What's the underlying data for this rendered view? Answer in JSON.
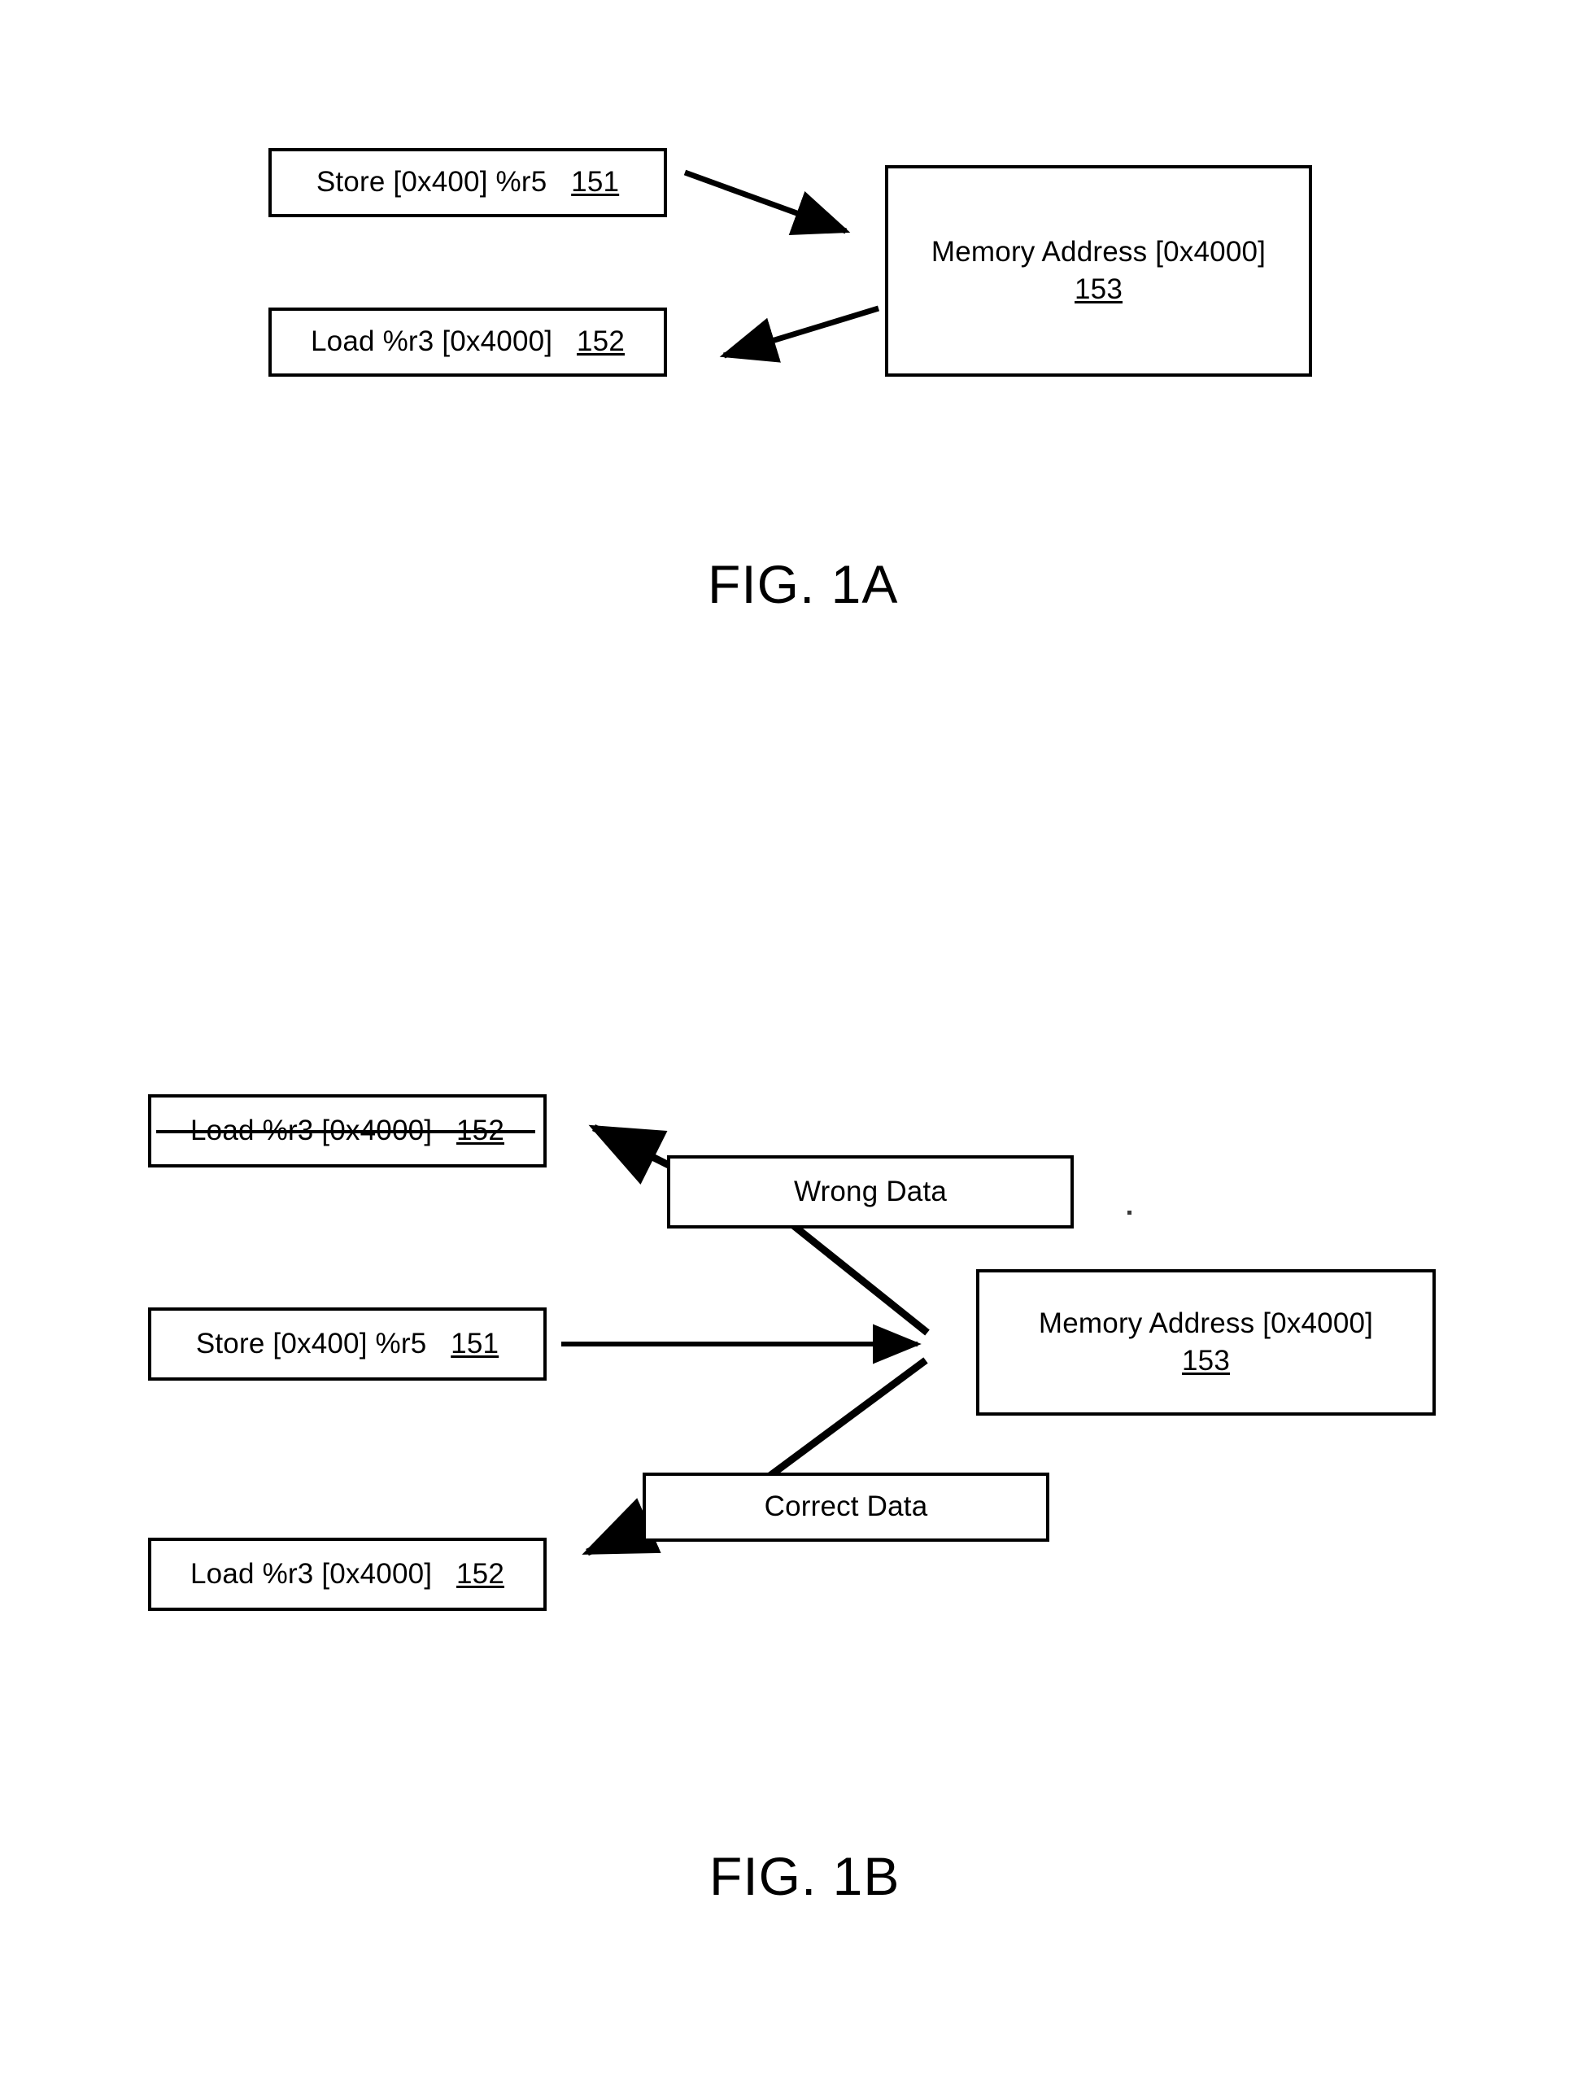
{
  "document": {
    "type": "patent-figure-sheet",
    "background_color": "#ffffff",
    "line_color": "#000000"
  },
  "figures": [
    {
      "id": "fig-1a",
      "caption": "FIG. 1A",
      "nodes": {
        "store": {
          "label": "Store [0x400] %r5",
          "ref": "151"
        },
        "load": {
          "label": "Load %r3 [0x4000]",
          "ref": "152"
        },
        "memory": {
          "label": "Memory Address [0x4000]",
          "ref": "153"
        }
      },
      "edges": [
        {
          "name": "store-to-memory",
          "from": "store",
          "to": "memory",
          "label": ""
        },
        {
          "name": "memory-to-load",
          "from": "memory",
          "to": "load",
          "label": ""
        }
      ]
    },
    {
      "id": "fig-1b",
      "caption": "FIG. 1B",
      "nodes": {
        "load_struck": {
          "label": "Load %r3 [0x4000]",
          "ref": "152",
          "struck_through": true
        },
        "store": {
          "label": "Store [0x400] %r5",
          "ref": "151"
        },
        "load": {
          "label": "Load %r3 [0x4000]",
          "ref": "152",
          "struck_through": false
        },
        "memory": {
          "label": "Memory Address [0x4000]",
          "ref": "153"
        },
        "wrong_data": {
          "label": "Wrong Data"
        },
        "correct_data": {
          "label": "Correct Data"
        }
      },
      "edges": [
        {
          "name": "store-to-memory",
          "from": "store",
          "to": "memory",
          "label": ""
        },
        {
          "name": "memory-to-wrong-data",
          "from": "memory",
          "to": "wrong_data",
          "label": ""
        },
        {
          "name": "wrong-data-to-load-struck",
          "from": "wrong_data",
          "to": "load_struck",
          "label": ""
        },
        {
          "name": "memory-to-correct-data",
          "from": "memory",
          "to": "correct_data",
          "label": ""
        },
        {
          "name": "correct-data-to-load",
          "from": "correct_data",
          "to": "load",
          "label": ""
        }
      ]
    }
  ]
}
